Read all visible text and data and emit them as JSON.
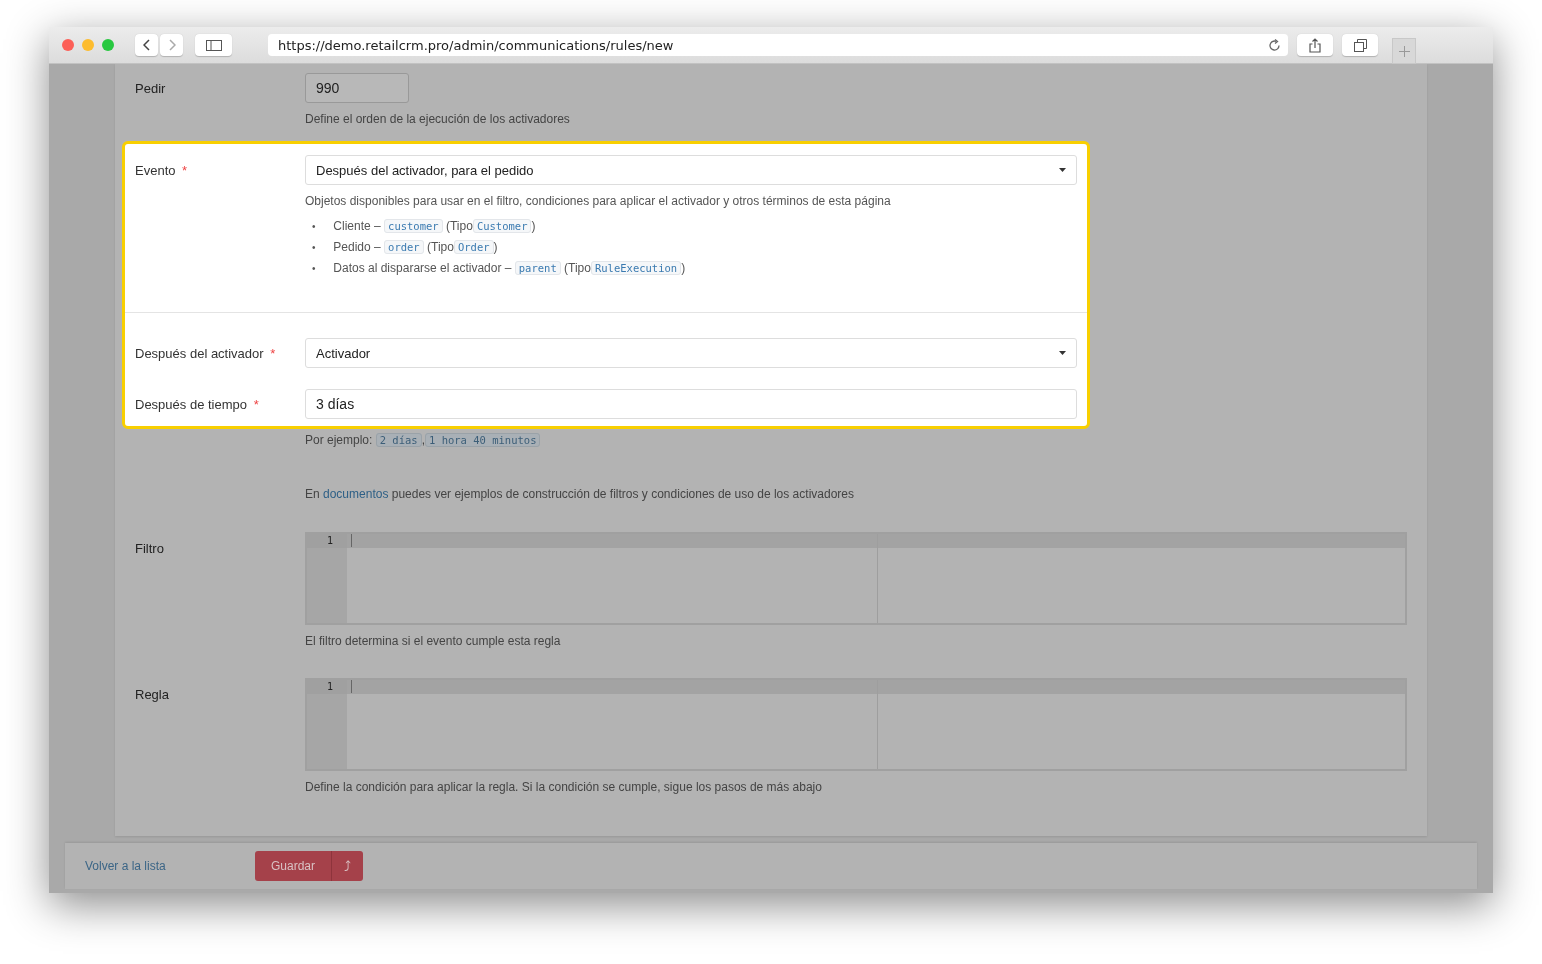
{
  "browser": {
    "url": "https://demo.retailcrm.pro/admin/communications/rules/new"
  },
  "form": {
    "before": [
      {
        "kind": "input",
        "label": "Pedir",
        "value": "990",
        "help": "Define el orden de la ejecución de los activadores"
      }
    ],
    "highlighted": [
      {
        "kind": "select",
        "label": "Evento",
        "required_mark": "*",
        "value": "Después del activador, para el pedido",
        "help": "Objetos disponibles para usar en el filtro, condiciones para aplicar el activador y otros términos de esta página",
        "objects": [
          {
            "bullet": "•",
            "name": "Cliente –",
            "code": "customer",
            "type_label": "(Tipo",
            "type_code": "Customer",
            "suffix": ")"
          },
          {
            "bullet": "•",
            "name": "Pedido –",
            "code": "order",
            "type_label": "(Tipo",
            "type_code": "Order",
            "suffix": ")"
          },
          {
            "bullet": "•",
            "name": "Datos al dispararse el activador –",
            "code": "parent",
            "type_label": "(Tipo",
            "type_code": "RuleExecution",
            "suffix": ")"
          }
        ]
      },
      {
        "kind": "select",
        "label": "Después del activador",
        "required_mark": "*",
        "value": "Activador"
      },
      {
        "kind": "input",
        "label": "Después de tiempo",
        "required_mark": "*",
        "value": "3 días"
      }
    ],
    "after": [
      {
        "kind": "examples",
        "text": "Por ejemplo:",
        "codes": [
          "2 días",
          "1 hora 40 minutos"
        ],
        "separator": ","
      },
      {
        "kind": "note",
        "prefix": "En",
        "link": "documentos",
        "text": "puedes ver ejemplos de construcción de filtros y condiciones de uso de los activadores"
      },
      {
        "kind": "editor",
        "label": "Filtro",
        "line_number": "1",
        "help": "El filtro determina si el evento cumple esta regla"
      },
      {
        "kind": "editor",
        "label": "Regla",
        "line_number": "1",
        "help": "Define la condición para aplicar la regla. Si la condición se cumple, sigue los pasos de más abajo"
      }
    ]
  },
  "footer": {
    "back_link": "Volver a la lista",
    "save_button": "Guardar",
    "save_menu_icon": "⤴"
  }
}
